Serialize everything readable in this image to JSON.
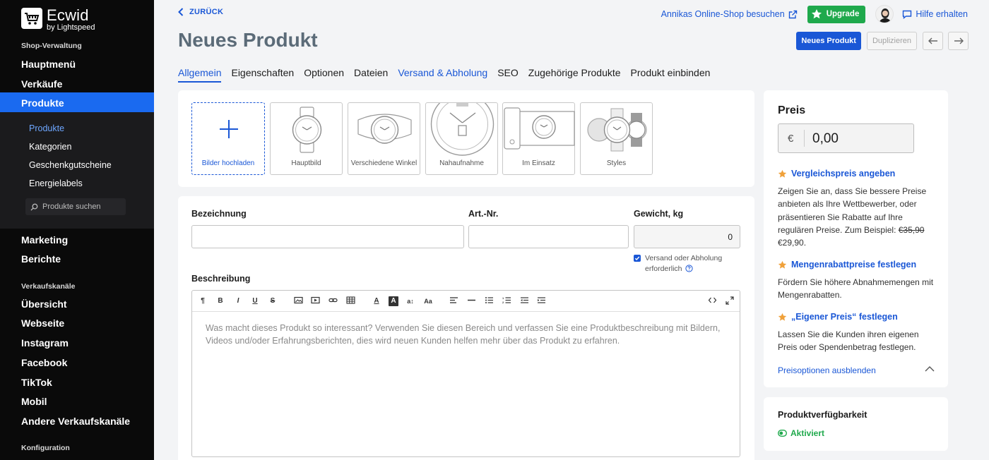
{
  "sidebar": {
    "logo": {
      "name": "Ecwid",
      "sub": "by Lightspeed"
    },
    "section_shop": "Shop-Verwaltung",
    "main_menu": "Hauptmenü",
    "sales": "Verkäufe",
    "products": "Produkte",
    "sub_items": [
      "Produkte",
      "Kategorien",
      "Geschenkgutscheine",
      "Energielabels"
    ],
    "search_placeholder": "Produkte suchen",
    "marketing": "Marketing",
    "reports": "Berichte",
    "section_channels": "Verkaufskanäle",
    "channels": [
      "Übersicht",
      "Webseite",
      "Instagram",
      "Facebook",
      "TikTok",
      "Mobil",
      "Andere Verkaufskanäle"
    ],
    "section_config": "Konfiguration"
  },
  "header": {
    "back_label": "ZURÜCK",
    "visit_shop": "Annikas Online-Shop besuchen",
    "upgrade": "Upgrade",
    "help": "Hilfe erhalten",
    "title": "Neues Produkt",
    "btn_new": "Neues Produkt",
    "btn_duplicate": "Duplizieren"
  },
  "tabs": [
    "Allgemein",
    "Eigenschaften",
    "Optionen",
    "Dateien",
    "Versand & Abholung",
    "SEO",
    "Zugehörige Produkte",
    "Produkt einbinden"
  ],
  "images": {
    "upload": "Bilder hochladen",
    "tiles": [
      "Hauptbild",
      "Verschiedene Winkel",
      "Nahaufnahme",
      "Im Einsatz",
      "Styles"
    ]
  },
  "form": {
    "name_label": "Bezeichnung",
    "name_value": "",
    "sku_label": "Art.-Nr.",
    "sku_value": "",
    "weight_label": "Gewicht, kg",
    "weight_value": "0",
    "shipping_checkbox": "Versand oder Abholung erforderlich",
    "shipping_checked": true,
    "description_label": "Beschreibung",
    "description_placeholder": "Was macht dieses Produkt so interessant? Verwenden Sie diesen Bereich und verfassen Sie eine Produktbeschreibung mit Bildern, Videos und/oder Erfahrungsberichten, dies wird neuen Kunden helfen mehr über das Produkt zu erfahren."
  },
  "price": {
    "title": "Preis",
    "currency": "€",
    "value": "0,00",
    "options": [
      {
        "title": "Vergleichspreis angeben",
        "text_before": "Zeigen Sie an, dass Sie bessere Preise anbieten als Ihre Wettbewerber, oder präsentieren Sie Rabatte auf Ihre regulären Preise. Zum Beispiel: ",
        "strike": "€35,90",
        "text_after": " €29,90."
      },
      {
        "title": "Mengenrabattpreise festlegen",
        "text": "Fördern Sie höhere Abnahmemengen mit Mengenrabatten."
      },
      {
        "title": "„Eigener Preis“ festlegen",
        "text": "Lassen Sie die Kunden ihren eigenen Preis oder Spendenbetrag festlegen."
      }
    ],
    "hide_options": "Preisoptionen ausblenden"
  },
  "availability": {
    "title": "Produktverfügbarkeit",
    "status": "Aktiviert"
  },
  "colors": {
    "accent": "#1a57d6",
    "sidebar_active": "#1a6af0",
    "success": "#1fa94c"
  }
}
